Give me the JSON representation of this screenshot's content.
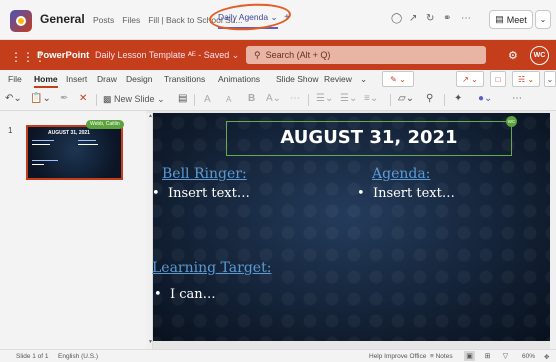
{
  "teams": {
    "channel": "General",
    "tabs": [
      "Posts",
      "Files",
      "Fill | Back to School Su..."
    ],
    "active_tab": "Daily Agenda",
    "active_tab_chevron": "⌄",
    "add_tab": "+",
    "meet_label": "Meet",
    "meet_chevron": "⌄"
  },
  "ppt": {
    "app_name": "PowerPoint",
    "doc_title": "Daily Lesson Template",
    "saved_status": "- Saved",
    "search_placeholder": "Search (Alt + Q)",
    "user_initials": "WC"
  },
  "ribbon": {
    "tabs": [
      "File",
      "Home",
      "Insert",
      "Draw",
      "Design",
      "Transitions",
      "Animations",
      "Slide Show",
      "Review"
    ],
    "active_tab": "Home",
    "new_slide": "New Slide",
    "font_grow": "A",
    "font_shrink": "A",
    "bold": "B"
  },
  "thumbnail": {
    "number": "1",
    "title": "AUGUST 31, 2021",
    "editor_label": "Webb, Caitlin"
  },
  "slide": {
    "title": "AUGUST 31, 2021",
    "editor_initials": "WC",
    "bell_ringer_heading": "Bell Ringer:",
    "bell_ringer_bullet": "Insert text…",
    "agenda_heading": "Agenda:",
    "agenda_bullet": "Insert text…",
    "learning_target_heading": "Learning Target:",
    "learning_target_bullet": "I can…",
    "bullet_char": "•"
  },
  "status": {
    "slide_count": "Slide 1 of 1",
    "language": "English (U.S.)",
    "help": "Help Improve Office",
    "notes": "Notes",
    "zoom": "60%"
  },
  "colors": {
    "ppt_accent": "#c43e1c",
    "teams_accent": "#5b5fc7",
    "annotation_circle": "#e35d26",
    "heading_blue": "#5b9bd5",
    "presence_green": "#5ca33e"
  }
}
